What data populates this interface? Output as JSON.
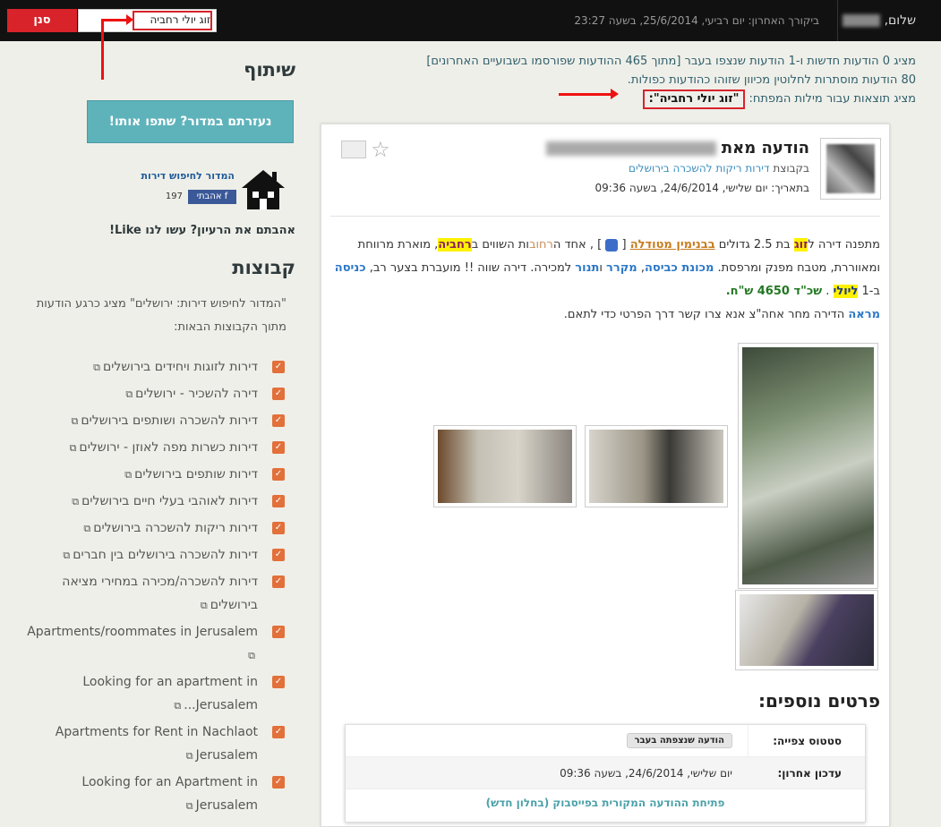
{
  "topbar": {
    "greeting": "שלום,",
    "last_visit": "ביקורך האחרון: יום רביעי, 25/6/2014, בשעה 23:27",
    "search_value": "זוג יולי רחביה",
    "filter_label": "סנן"
  },
  "info": {
    "line1": "מציג 0 הודעות חדשות ו-1 הודעות שנצפו בעבר [מתוך 465 ההודעות שפורסמו בשבועיים האחרונים]",
    "line2": "80 הודעות מוסתרות לחלוטין מכיוון שזוהו כהודעות כפולות.",
    "line3_prefix": "מציג תוצאות עבור מילות המפתח:",
    "keywords": "\"זוג יולי רחביה\":"
  },
  "sidebar": {
    "share_heading": "שיתוף",
    "share_button": "נעזרתם במדור? שתפו אותו!",
    "guide_title": "המדור לחיפוש דירות",
    "fb_like": "אהבתי",
    "fb_count": "197",
    "like_question": "אהבתם את הרעיון? עשו לנו Like!",
    "groups_heading": "קבוצות",
    "groups_desc": "\"המדור לחיפוש דירות: ירושלים\" מציג כרגע הודעות מתוך הקבוצות הבאות:",
    "groups": [
      {
        "label": "דירות לזוגות ויחידים בירושלים"
      },
      {
        "label": "דירה להשכיר - ירושלים"
      },
      {
        "label": "דירות להשכרה ושותפים בירושלים"
      },
      {
        "label": "דירות כשרות מפה לאוזן - ירושלים"
      },
      {
        "label": "דירות שותפים בירושלים"
      },
      {
        "label": "דירות לאוהבי בעלי חיים בירושלים"
      },
      {
        "label": "דירות ריקות להשכרה בירושלים"
      },
      {
        "label": "דירות להשכרה בירושלים בין חברים"
      },
      {
        "label": "דירות להשכרה/מכירה במחירי מציאה בירושלים"
      },
      {
        "label": "Apartments/roommates in Jerusalem"
      },
      {
        "label": "Looking for an apartment in Jerusalem..."
      },
      {
        "label": "Apartments for Rent in Nachlaot Jerusalem"
      },
      {
        "label": "Looking for an Apartment in Jerusalem"
      }
    ]
  },
  "post": {
    "title": "הודעה מאת",
    "group_prefix": "בקבוצת",
    "group_link": "דירות ריקות להשכרה בירושלים",
    "date": "בתאריך: יום שלישי, 24/6/2014, בשעה 09:36",
    "body": {
      "t1": "מתפנה דירה ל",
      "w_couple": "זוג",
      "t2": " בת 2.5 גדולים ",
      "w_street": "בבנימין מטודלה",
      "t3": " [ ",
      "t4": " ] , אחד ה",
      "w_streets": "רחוב",
      "t5": "ות השווים ב",
      "w_area": "רחביה",
      "t6": ", מוארת מרווחת ומאווררת, מטבח מפנק ומרפסת. ",
      "w_wash": "מכונת כביסה",
      "t7": ", ",
      "w_fridge": "מקרר",
      "t8": " ו",
      "w_oven": "תנור",
      "t9": " למכירה. דירה שווה !! מועברת בצער רב, ",
      "w_entry": "כניסה",
      "t10": " ב-1 ",
      "w_july": "ליולי",
      "t11": " . ",
      "w_price": "שכ\"ד 4650 ש\"ח.",
      "w_view": "מראה",
      "t12": " הדירה מחר אחה\"צ אנא צרו קשר דרך הפרטי כדי לתאם."
    },
    "more_heading": "פרטים נוספים:",
    "details": {
      "status_label": "סטטוס צפייה:",
      "status_value": "הודעה שנצפתה בעבר",
      "update_label": "עדכון אחרון:",
      "update_value": "יום שלישי, 24/6/2014, בשעה 09:36",
      "open_link": "פתיחת ההודעה המקורית בפייסבוק (בחלון חדש)"
    }
  },
  "colors": {
    "accent_red": "#d8232a",
    "share_teal": "#5eb3bb",
    "highlight_yellow": "#fff200",
    "link_blue": "#3c8fbf"
  }
}
